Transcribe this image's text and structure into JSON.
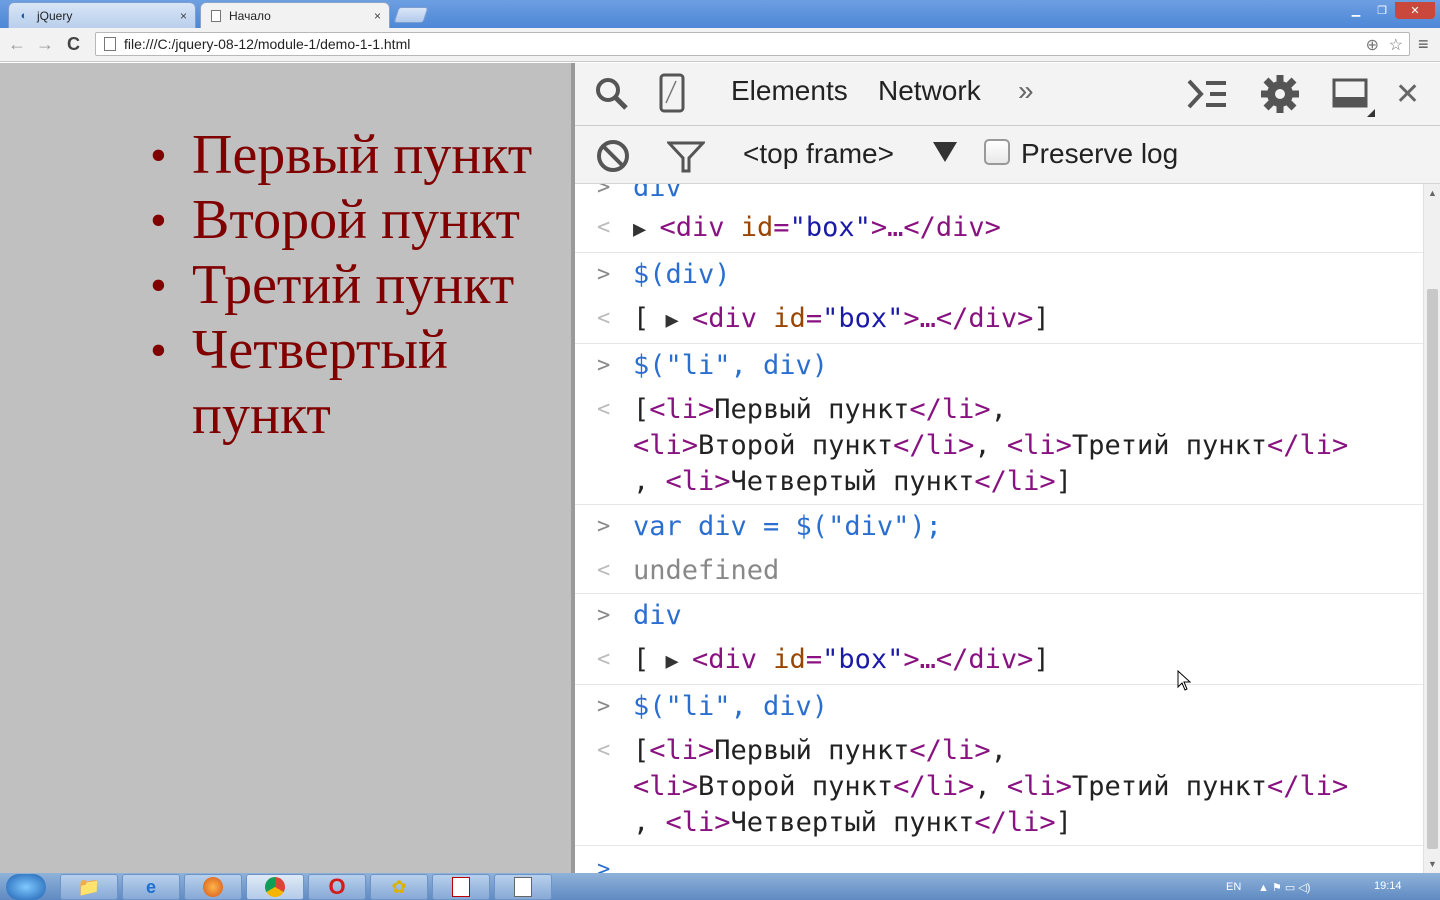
{
  "browser": {
    "tabs": [
      {
        "title": "jQuery",
        "icon": "jquery-icon",
        "active": false
      },
      {
        "title": "Начало",
        "icon": "page-icon",
        "active": true
      }
    ],
    "close_glyph": "×",
    "url": "file:///C:/jquery-08-12/module-1/demo-1-1.html",
    "nav": {
      "back": "←",
      "forward": "→",
      "reload": "C"
    },
    "window_controls": {
      "minimize": "▁",
      "maximize": "❐",
      "close": "✕"
    }
  },
  "page": {
    "list_items": [
      "Первый пункт",
      "Второй пункт",
      "Третий пункт",
      "Четвертый пункт"
    ],
    "text_color": "#800000",
    "background": "#c0c0c0"
  },
  "devtools": {
    "tabs": [
      "Elements",
      "Network"
    ],
    "more": "»",
    "frame_select": "<top frame>",
    "preserve_log_label": "Preserve log",
    "preserve_log_checked": false,
    "console": {
      "partial_input": "div",
      "entries": [
        {
          "type": "out",
          "segments": [
            {
              "cls": "tri",
              "text": "▶ "
            },
            {
              "cls": "tag",
              "text": "<div "
            },
            {
              "cls": "attr",
              "text": "id"
            },
            {
              "cls": "tag",
              "text": "="
            },
            {
              "cls": "val",
              "text": "\"box\""
            },
            {
              "cls": "tag",
              "text": ">…</div>"
            }
          ]
        },
        {
          "type": "in",
          "text": "$(div)"
        },
        {
          "type": "out",
          "segments": [
            {
              "cls": "plain",
              "text": "[ "
            },
            {
              "cls": "tri",
              "text": "▶ "
            },
            {
              "cls": "tag",
              "text": "<div "
            },
            {
              "cls": "attr",
              "text": "id"
            },
            {
              "cls": "tag",
              "text": "="
            },
            {
              "cls": "val",
              "text": "\"box\""
            },
            {
              "cls": "tag",
              "text": ">…</div>"
            },
            {
              "cls": "plain",
              "text": "]"
            }
          ]
        },
        {
          "type": "in",
          "text": "$(\"li\", div)"
        },
        {
          "type": "out",
          "lines": [
            [
              {
                "cls": "plain",
                "text": "["
              },
              {
                "cls": "tag",
                "text": "<li>"
              },
              {
                "cls": "plain",
                "text": "Первый пункт"
              },
              {
                "cls": "tag",
                "text": "</li>"
              },
              {
                "cls": "plain",
                "text": ","
              }
            ],
            [
              {
                "cls": "tag",
                "text": "<li>"
              },
              {
                "cls": "plain",
                "text": "Второй пункт"
              },
              {
                "cls": "tag",
                "text": "</li>"
              },
              {
                "cls": "plain",
                "text": ", "
              },
              {
                "cls": "tag",
                "text": "<li>"
              },
              {
                "cls": "plain",
                "text": "Третий пункт"
              },
              {
                "cls": "tag",
                "text": "</li>"
              }
            ],
            [
              {
                "cls": "plain",
                "text": ", "
              },
              {
                "cls": "tag",
                "text": "<li>"
              },
              {
                "cls": "plain",
                "text": "Четвертый пункт"
              },
              {
                "cls": "tag",
                "text": "</li>"
              },
              {
                "cls": "plain",
                "text": "]"
              }
            ]
          ]
        },
        {
          "type": "in",
          "text": "var div = $(\"div\");"
        },
        {
          "type": "out",
          "segments": [
            {
              "cls": "muted",
              "text": "undefined"
            }
          ]
        },
        {
          "type": "in",
          "text": "div"
        },
        {
          "type": "out",
          "segments": [
            {
              "cls": "plain",
              "text": "[ "
            },
            {
              "cls": "tri",
              "text": "▶ "
            },
            {
              "cls": "tag",
              "text": "<div "
            },
            {
              "cls": "attr",
              "text": "id"
            },
            {
              "cls": "tag",
              "text": "="
            },
            {
              "cls": "val",
              "text": "\"box\""
            },
            {
              "cls": "tag",
              "text": ">…</div>"
            },
            {
              "cls": "plain",
              "text": "]"
            }
          ]
        },
        {
          "type": "in",
          "text": "$(\"li\", div)"
        },
        {
          "type": "out",
          "lines": [
            [
              {
                "cls": "plain",
                "text": "["
              },
              {
                "cls": "tag",
                "text": "<li>"
              },
              {
                "cls": "plain",
                "text": "Первый пункт"
              },
              {
                "cls": "tag",
                "text": "</li>"
              },
              {
                "cls": "plain",
                "text": ","
              }
            ],
            [
              {
                "cls": "tag",
                "text": "<li>"
              },
              {
                "cls": "plain",
                "text": "Второй пункт"
              },
              {
                "cls": "tag",
                "text": "</li>"
              },
              {
                "cls": "plain",
                "text": ", "
              },
              {
                "cls": "tag",
                "text": "<li>"
              },
              {
                "cls": "plain",
                "text": "Третий пункт"
              },
              {
                "cls": "tag",
                "text": "</li>"
              }
            ],
            [
              {
                "cls": "plain",
                "text": ", "
              },
              {
                "cls": "tag",
                "text": "<li>"
              },
              {
                "cls": "plain",
                "text": "Четвертый пункт"
              },
              {
                "cls": "tag",
                "text": "</li>"
              },
              {
                "cls": "plain",
                "text": "]"
              }
            ]
          ]
        }
      ],
      "prompt": ">",
      "in_glyph": ">",
      "out_glyph": "<"
    }
  },
  "taskbar": {
    "apps": [
      "explorer-icon",
      "ie-icon",
      "firefox-icon",
      "chrome-icon",
      "opera-icon",
      "icq-icon",
      "acrobat-icon",
      "notepad-icon"
    ],
    "language": "EN",
    "time": "19:14"
  }
}
